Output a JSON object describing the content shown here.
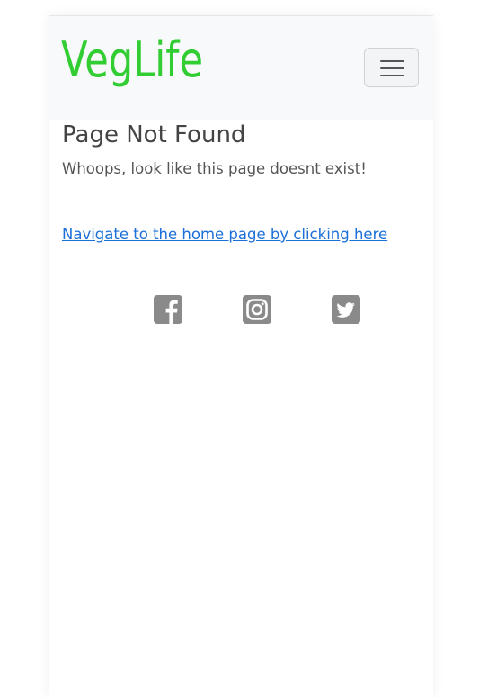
{
  "navbar": {
    "brand": "VegLife",
    "toggler_icon": "hamburger-menu-icon"
  },
  "main": {
    "title": "Page Not Found",
    "subtitle": "Whoops, look like this page doesnt exist!",
    "home_link": "Navigate to the home page by clicking here"
  },
  "footer": {
    "social": [
      {
        "icon": "facebook-icon"
      },
      {
        "icon": "instagram-icon"
      },
      {
        "icon": "twitter-icon"
      }
    ]
  },
  "colors": {
    "brand": "#32cd32",
    "navbar_bg": "#f8f9fa",
    "link": "#1a6fd8",
    "icon": "#8a8a8a",
    "text": "#555555"
  }
}
